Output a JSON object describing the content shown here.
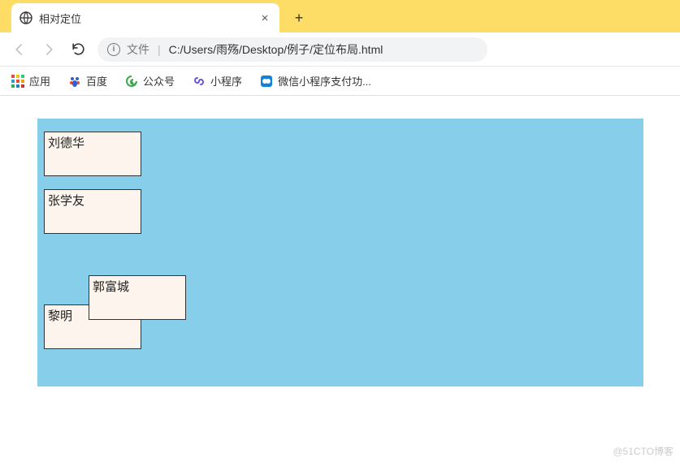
{
  "tab": {
    "title": "相对定位",
    "close": "×",
    "new_tab": "+"
  },
  "toolbar": {
    "back": "←",
    "forward": "→",
    "reload": "⟳"
  },
  "address": {
    "info": "i",
    "prefix": "文件",
    "separator": "|",
    "path": "C:/Users/雨殇/Desktop/例子/定位布局.html"
  },
  "bookmarks": {
    "apps": "应用",
    "baidu": "百度",
    "gzh": "公众号",
    "xcx": "小程序",
    "wxpay": "微信小程序支付功..."
  },
  "page": {
    "cells": [
      "刘德华",
      "张学友",
      "郭富城",
      "黎明"
    ]
  },
  "watermark": "@51CTO博客"
}
